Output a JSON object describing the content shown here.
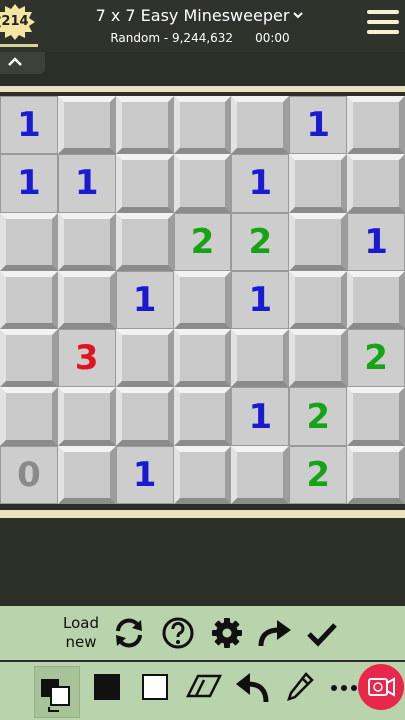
{
  "header": {
    "badge_count": "214",
    "title": "7 x 7 Easy Minesweeper",
    "puzzle_id": "Random - 9,244,632",
    "timer": "00:00"
  },
  "board": {
    "rows": 7,
    "cols": 7,
    "cells": [
      [
        "1",
        "",
        "",
        "",
        "",
        "1",
        ""
      ],
      [
        "1",
        "1",
        "",
        "",
        "1",
        "",
        ""
      ],
      [
        "",
        "",
        "",
        "2",
        "2",
        "",
        "1"
      ],
      [
        "",
        "",
        "1",
        "",
        "1",
        "",
        ""
      ],
      [
        "",
        "3",
        "",
        "",
        "",
        "",
        "2"
      ],
      [
        "",
        "",
        "",
        "",
        "1",
        "2",
        ""
      ],
      [
        "0",
        "",
        "1",
        "",
        "",
        "2",
        ""
      ]
    ],
    "open": [
      [
        1,
        0,
        0,
        0,
        0,
        1,
        0
      ],
      [
        1,
        1,
        0,
        0,
        1,
        0,
        0
      ],
      [
        0,
        0,
        0,
        1,
        1,
        0,
        1
      ],
      [
        0,
        0,
        1,
        0,
        1,
        0,
        0
      ],
      [
        0,
        1,
        0,
        0,
        0,
        0,
        1
      ],
      [
        0,
        0,
        0,
        0,
        1,
        1,
        0
      ],
      [
        1,
        0,
        1,
        0,
        0,
        1,
        0
      ]
    ],
    "number_colors": {
      "0": "#8a8a8a",
      "1": "#1a1ad0",
      "2": "#16a316",
      "3": "#e0141e"
    }
  },
  "toolbar": {
    "load_new_line1": "Load",
    "load_new_line2": "new"
  },
  "icons": {
    "refresh": "refresh-icon",
    "help": "help-icon",
    "settings": "gear-icon",
    "redo": "redo-icon",
    "check": "check-icon",
    "tool_toggle": "fill-toggle-icon",
    "tool_black": "black-square-icon",
    "tool_white": "white-square-icon",
    "eraser": "eraser-icon",
    "undo": "undo-icon",
    "pencil": "pencil-icon",
    "more": "more-icon",
    "record": "record-video-icon"
  },
  "colors": {
    "accent_toolbar": "#b9d3ac",
    "record_button": "#e8274b"
  }
}
